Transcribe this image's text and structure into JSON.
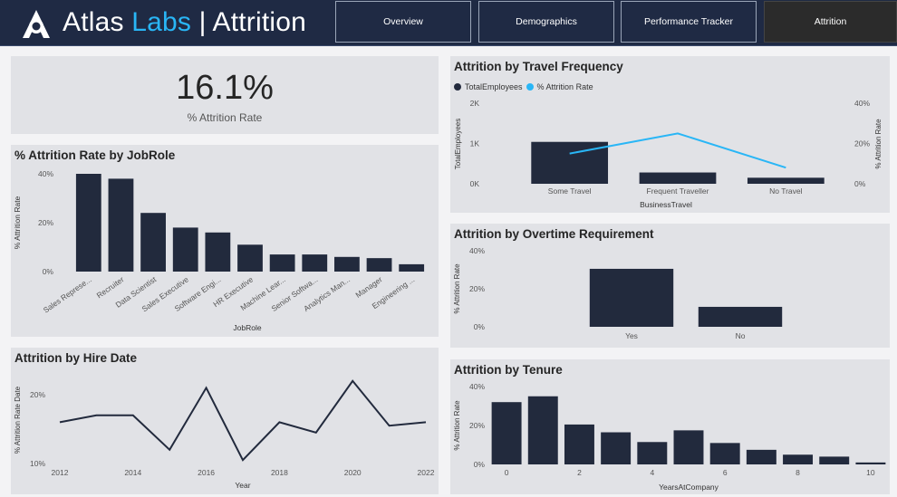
{
  "header": {
    "title_part1": "Atlas",
    "title_part2": "Labs",
    "title_part3": "| Attrition",
    "logo_icon": "atlas-logo-icon",
    "accent_color": "#29b6f6",
    "nav": [
      {
        "label": "Overview",
        "active": false
      },
      {
        "label": "Demographics",
        "active": false
      },
      {
        "label": "Performance Tracker",
        "active": false
      },
      {
        "label": "Attrition",
        "active": true
      }
    ]
  },
  "kpi": {
    "value": "16.1%",
    "label": "% Attrition Rate"
  },
  "colors": {
    "bar": "#222a3d",
    "line": "#29b6f6",
    "card": "#e1e2e6"
  },
  "chart_data": [
    {
      "id": "jobrole",
      "type": "bar",
      "title": "% Attrition Rate by JobRole",
      "xlabel": "JobRole",
      "ylabel": "% Attrition Rate",
      "yticks": [
        "0%",
        "20%",
        "40%"
      ],
      "ylim": [
        0,
        40
      ],
      "categories": [
        "Sales Represe...",
        "Recruiter",
        "Data Scientist",
        "Sales Executive",
        "Software Engi...",
        "HR Executive",
        "Machine Lear...",
        "Senior Softwa...",
        "Analytics Man...",
        "Manager",
        "Engineering ..."
      ],
      "values": [
        40,
        38,
        24,
        18,
        16,
        11,
        7,
        7,
        6,
        5.5,
        3
      ]
    },
    {
      "id": "hiredate",
      "type": "line",
      "title": "Attrition by Hire Date",
      "xlabel": "Year",
      "ylabel": "% Attrition Rate Date",
      "yticks": [
        "10%",
        "20%"
      ],
      "ylim": [
        10,
        20
      ],
      "xticks": [
        "2012",
        "2014",
        "2016",
        "2018",
        "2020",
        "2022"
      ],
      "x": [
        2012,
        2013,
        2014,
        2015,
        2016,
        2017,
        2018,
        2019,
        2020,
        2021,
        2022
      ],
      "values": [
        16,
        17,
        17,
        12,
        21,
        10.5,
        16,
        14.5,
        22,
        15.5,
        16
      ]
    },
    {
      "id": "travel",
      "type": "bar",
      "title": "Attrition by Travel Frequency",
      "xlabel": "BusinessTravel",
      "ylabel": "TotalEmployees",
      "y2label": "% Attrition Rate",
      "legend": [
        "TotalEmployees",
        "% Attrition Rate"
      ],
      "yticks": [
        "0K",
        "1K",
        "2K"
      ],
      "y2ticks": [
        "0%",
        "20%",
        "40%"
      ],
      "ylim": [
        0,
        2000
      ],
      "y2lim": [
        0,
        40
      ],
      "categories": [
        "Some Travel",
        "Frequent Traveller",
        "No Travel"
      ],
      "series": [
        {
          "name": "TotalEmployees",
          "values": [
            1040,
            280,
            150
          ]
        },
        {
          "name": "% Attrition Rate",
          "values": [
            15,
            25,
            8
          ]
        }
      ]
    },
    {
      "id": "overtime",
      "type": "bar",
      "title": "Attrition by Overtime Requirement",
      "ylabel": "% Attrition Rate",
      "yticks": [
        "0%",
        "20%",
        "40%"
      ],
      "ylim": [
        0,
        40
      ],
      "categories": [
        "Yes",
        "No"
      ],
      "values": [
        30.5,
        10.5
      ]
    },
    {
      "id": "tenure",
      "type": "bar",
      "title": "Attrition by Tenure",
      "xlabel": "YearsAtCompany",
      "ylabel": "% Attrition Rate",
      "yticks": [
        "0%",
        "20%",
        "40%"
      ],
      "xticks": [
        "0",
        "2",
        "4",
        "6",
        "8",
        "10"
      ],
      "ylim": [
        0,
        40
      ],
      "categories": [
        "0",
        "1",
        "2",
        "3",
        "4",
        "5",
        "6",
        "7",
        "8",
        "9",
        "10"
      ],
      "values": [
        32,
        35,
        20.5,
        16.5,
        11.5,
        17.5,
        11,
        7.5,
        5,
        4,
        1
      ]
    }
  ]
}
